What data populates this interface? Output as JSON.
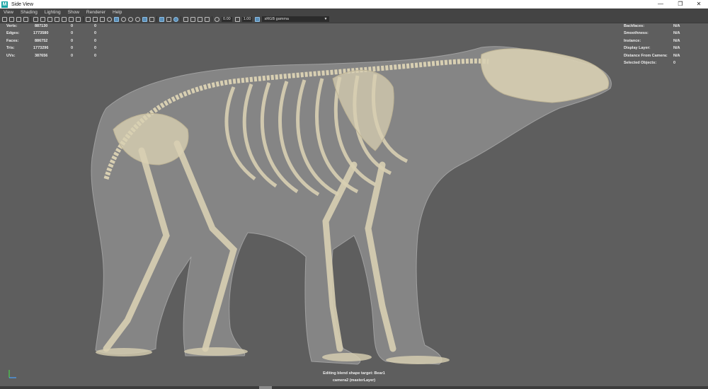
{
  "window": {
    "app_icon": "M",
    "title": "Side View",
    "minimize": "—",
    "restore": "❐",
    "close": "✕"
  },
  "menu": [
    "View",
    "Shading",
    "Lighting",
    "Show",
    "Renderer",
    "Help"
  ],
  "toolbar": {
    "field_1": "0.00",
    "field_2": "1.00",
    "color_space": "sRGB gamma"
  },
  "hud_left": [
    {
      "label": "Verts:",
      "v1": "887130",
      "v2": "0",
      "v3": "0"
    },
    {
      "label": "Edges:",
      "v1": "1773580",
      "v2": "0",
      "v3": "0"
    },
    {
      "label": "Faces:",
      "v1": "886752",
      "v2": "0",
      "v3": "0"
    },
    {
      "label": "Tris:",
      "v1": "1773296",
      "v2": "0",
      "v3": "0"
    },
    {
      "label": "UVs:",
      "v1": "387656",
      "v2": "0",
      "v3": "0"
    }
  ],
  "hud_right": [
    {
      "label": "Backfaces:",
      "value": "N/A"
    },
    {
      "label": "Smoothness:",
      "value": "N/A"
    },
    {
      "label": "Instance:",
      "value": "N/A"
    },
    {
      "label": "Display Layer:",
      "value": "N/A"
    },
    {
      "label": "Distance From Camera:",
      "value": "N/A"
    },
    {
      "label": "Selected Objects:",
      "value": "0"
    }
  ],
  "status": {
    "line1": "Editing blend shape target: Bear1",
    "line2": "camera2 (masterLayer)"
  },
  "colors": {
    "viewport_bg": "#5e5e5e",
    "bear_skin": "#8c8c8c",
    "bone": "#d8cfb2",
    "active_icon": "#5a8fb8"
  }
}
